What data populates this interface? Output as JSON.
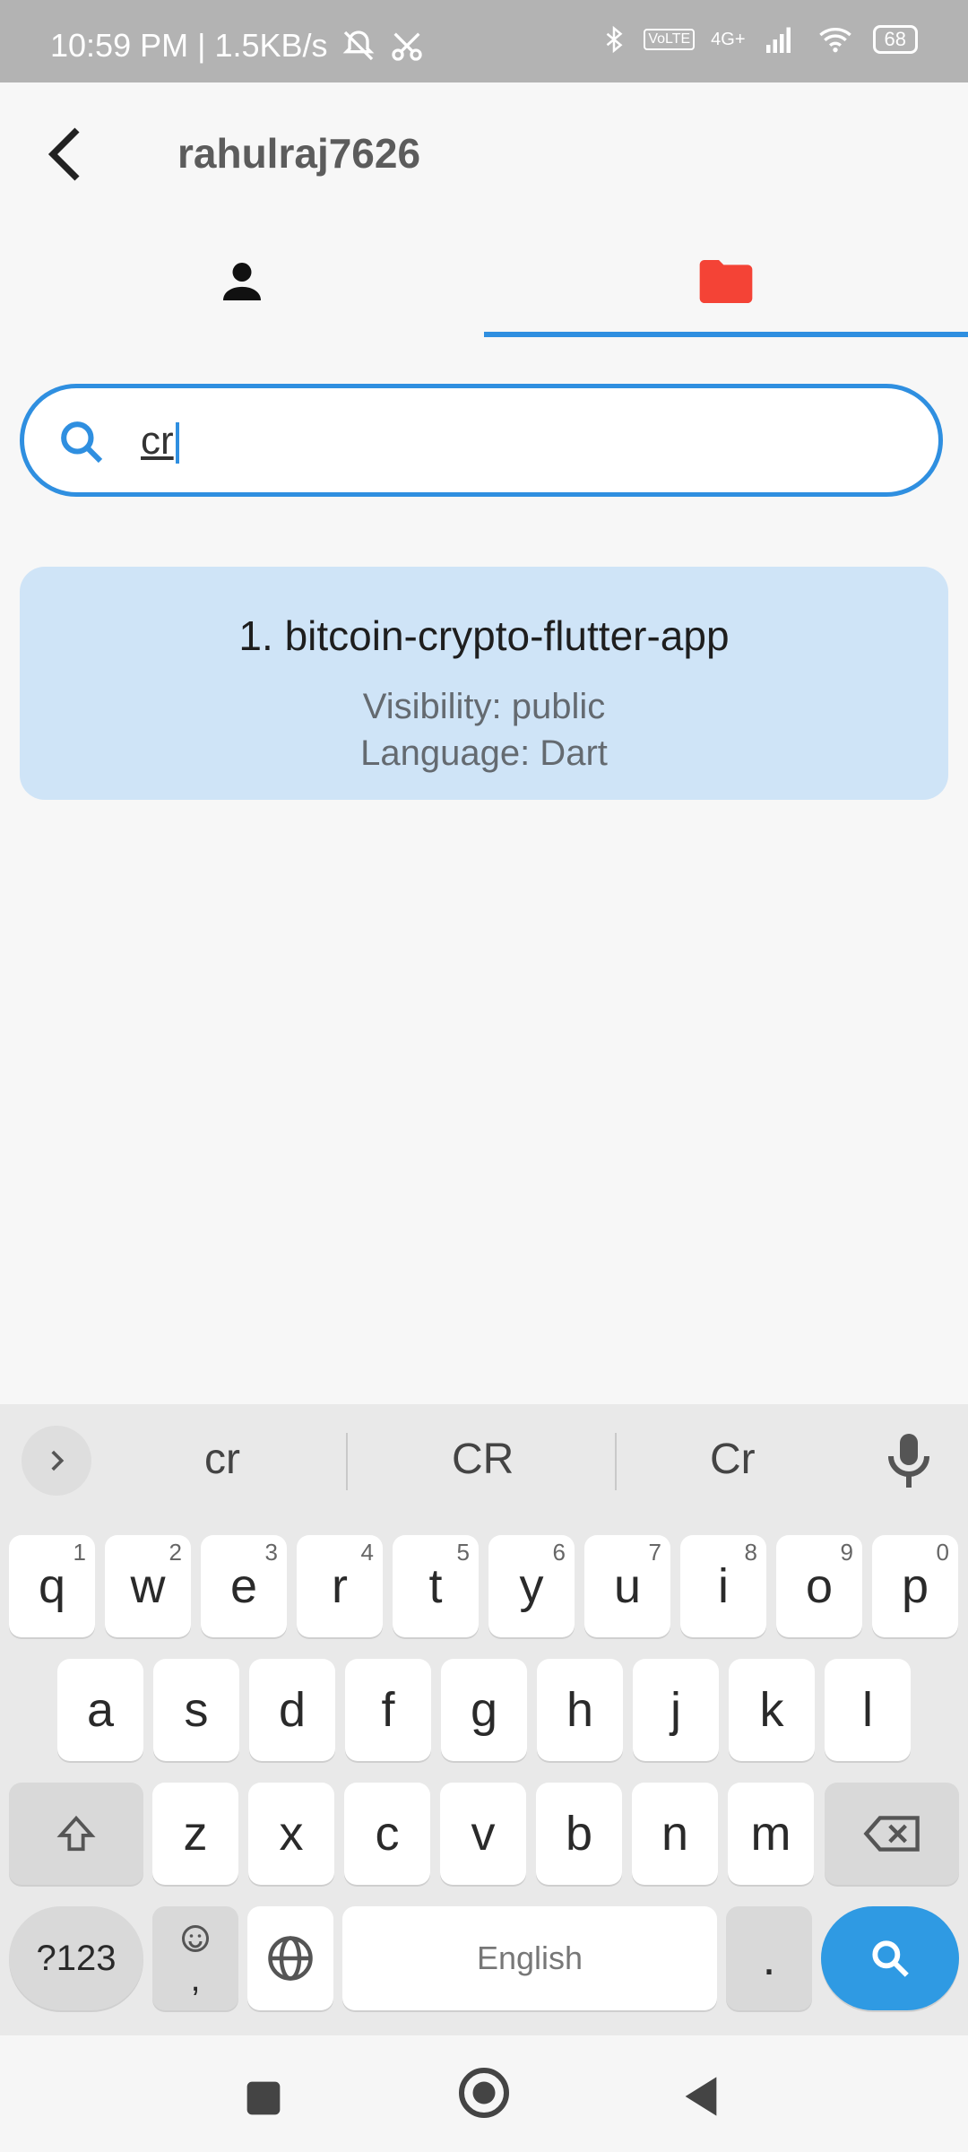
{
  "status": {
    "time_text": "10:59 PM | 1.5KB/s",
    "battery": "68",
    "network": "4G+"
  },
  "app_bar": {
    "title": "rahulraj7626"
  },
  "search": {
    "value": "cr"
  },
  "results": [
    {
      "title": "1. bitcoin-crypto-flutter-app",
      "visibility": "Visibility:  public",
      "language": "Language: Dart"
    }
  ],
  "keyboard": {
    "suggestions": [
      "cr",
      "CR",
      "Cr"
    ],
    "row1": [
      {
        "k": "q",
        "n": "1"
      },
      {
        "k": "w",
        "n": "2"
      },
      {
        "k": "e",
        "n": "3"
      },
      {
        "k": "r",
        "n": "4"
      },
      {
        "k": "t",
        "n": "5"
      },
      {
        "k": "y",
        "n": "6"
      },
      {
        "k": "u",
        "n": "7"
      },
      {
        "k": "i",
        "n": "8"
      },
      {
        "k": "o",
        "n": "9"
      },
      {
        "k": "p",
        "n": "0"
      }
    ],
    "row2": [
      "a",
      "s",
      "d",
      "f",
      "g",
      "h",
      "j",
      "k",
      "l"
    ],
    "row3": [
      "z",
      "x",
      "c",
      "v",
      "b",
      "n",
      "m"
    ],
    "symbols_label": "?123",
    "space_label": "English",
    "period_label": ".",
    "comma_label": ","
  },
  "colors": {
    "accent": "#2f8fe0",
    "card_bg": "#cfe4f7",
    "folder_red": "#f44336"
  }
}
